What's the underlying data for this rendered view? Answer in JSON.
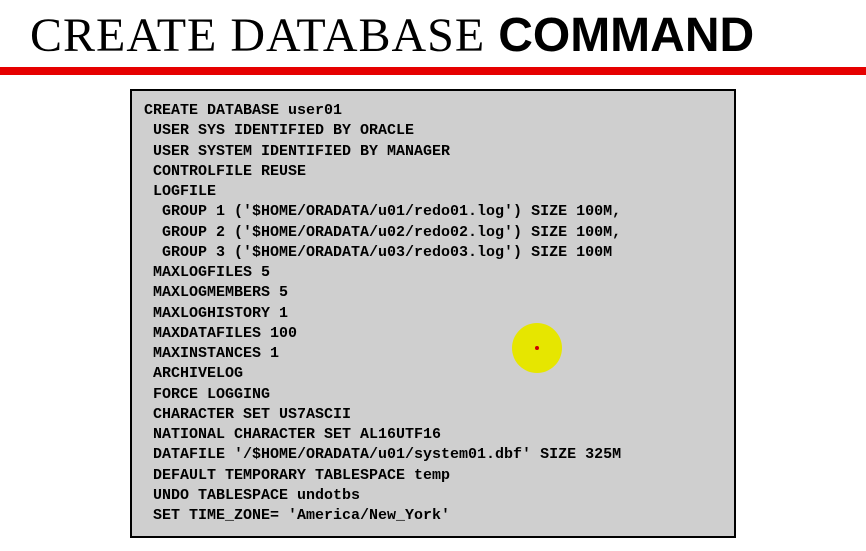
{
  "header": {
    "title_light": "CREATE DATABASE ",
    "title_bold": "COMMAND"
  },
  "code": {
    "lines_black": [
      "CREATE DATABASE user01",
      " USER SYS IDENTIFIED BY ORACLE",
      " USER SYSTEM IDENTIFIED BY MANAGER",
      " CONTROLFILE REUSE",
      " LOGFILE",
      "  GROUP 1 ('$HOME/ORADATA/u01/redo01.log') SIZE 100M,",
      "  GROUP 2 ('$HOME/ORADATA/u02/redo02.log') SIZE 100M,",
      "  GROUP 3 ('$HOME/ORADATA/u03/redo03.log') SIZE 100M",
      " MAXLOGFILES 5",
      " MAXLOGMEMBERS 5",
      " MAXLOGHISTORY 1",
      " MAXDATAFILES 100",
      " MAXINSTANCES 1",
      " ARCHIVELOG",
      " FORCE LOGGING",
      " CHARACTER SET US7ASCII",
      " NATIONAL CHARACTER SET AL16UTF16"
    ],
    "lines_blue": [
      " DATAFILE '/$HOME/ORADATA/u01/system01.dbf' SIZE 325M",
      " DEFAULT TEMPORARY TABLESPACE temp",
      " UNDO TABLESPACE undotbs",
      " SET TIME_ZONE= 'America/New_York'"
    ]
  }
}
